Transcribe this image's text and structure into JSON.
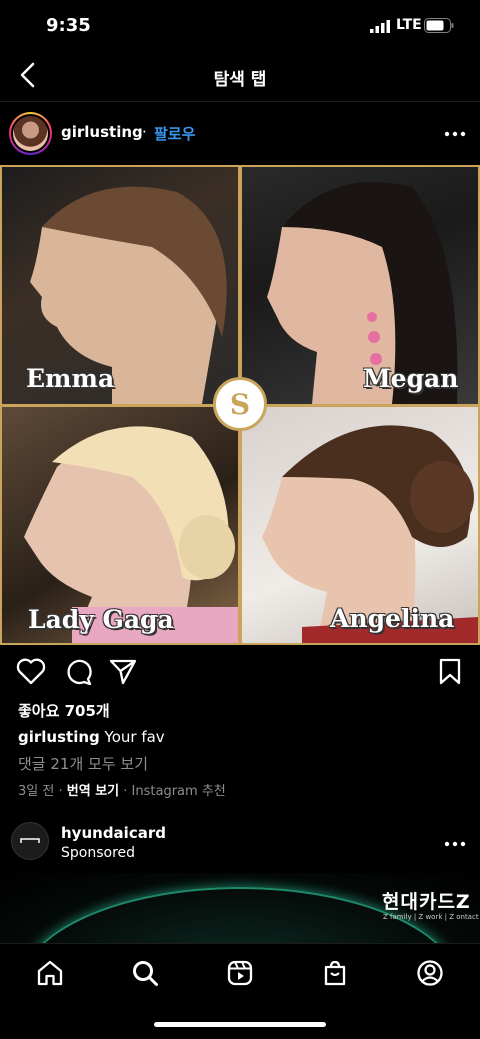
{
  "status": {
    "time": "9:35",
    "network": "LTE"
  },
  "nav": {
    "title": "탐색 탭"
  },
  "post": {
    "username": "girlusting",
    "separator": "·",
    "follow_label": "팔로우",
    "names": [
      "Emma",
      "Megan",
      "Lady Gaga",
      "Angelina"
    ],
    "likes": "좋아요 705개",
    "caption_user": "girlusting",
    "caption_text": "Your fav",
    "comments": "댓글 21개 모두 보기",
    "time": "3일 전",
    "meta_sep": "·",
    "translate": "번역 보기",
    "meta_sep2": "·",
    "recommend": "Instagram 추천"
  },
  "sponsored": {
    "username": "hyundaicard",
    "label": "Sponsored",
    "ad_brand": "현대카드Z",
    "ad_tagline": "Z family | Z work | Z ontact"
  },
  "colors": {
    "link": "#3897f0",
    "gold": "#c9a45a"
  }
}
